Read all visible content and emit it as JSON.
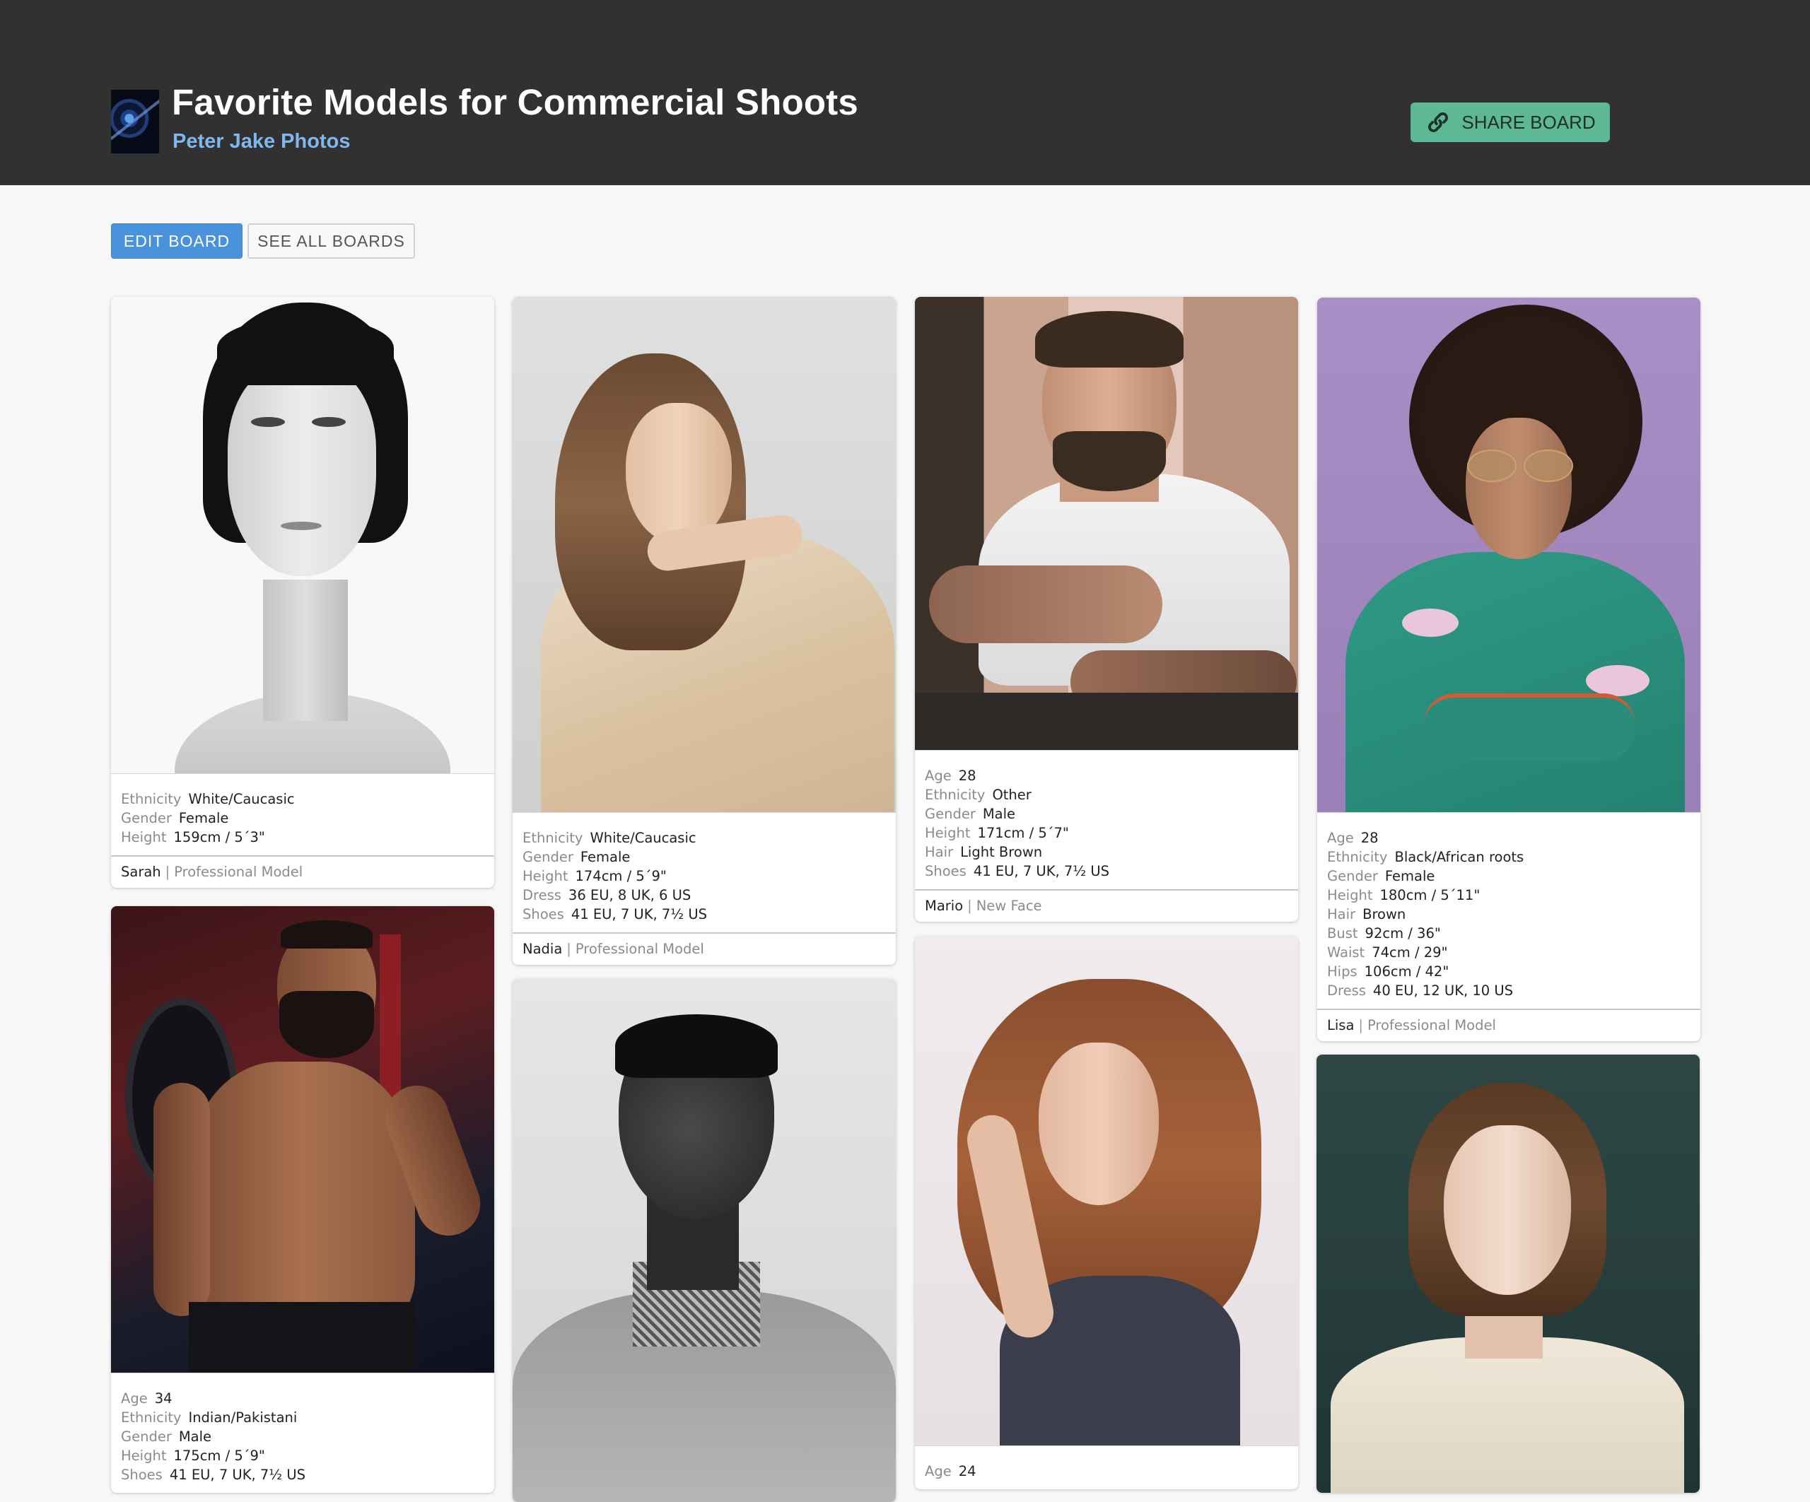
{
  "header": {
    "title": "Favorite Models for Commercial Shoots",
    "owner": "Peter Jake Photos",
    "share_label": "SHARE BOARD"
  },
  "toolbar": {
    "edit_label": "EDIT BOARD",
    "see_all_label": "SEE ALL BOARDS"
  },
  "cards": [
    {
      "name": "Sarah",
      "role": "Professional Model",
      "details": [
        {
          "k": "Ethnicity",
          "v": "White/Caucasic"
        },
        {
          "k": "Gender",
          "v": "Female"
        },
        {
          "k": "Height",
          "v": "159cm / 5´3\""
        }
      ]
    },
    {
      "name": "Nadia",
      "role": "Professional Model",
      "details": [
        {
          "k": "Ethnicity",
          "v": "White/Caucasic"
        },
        {
          "k": "Gender",
          "v": "Female"
        },
        {
          "k": "Height",
          "v": "174cm / 5´9\""
        },
        {
          "k": "Dress",
          "v": "36 EU, 8 UK, 6 US"
        },
        {
          "k": "Shoes",
          "v": "41 EU, 7 UK, 7½ US"
        }
      ]
    },
    {
      "name": "Mario",
      "role": "New Face",
      "details": [
        {
          "k": "Age",
          "v": "28"
        },
        {
          "k": "Ethnicity",
          "v": "Other"
        },
        {
          "k": "Gender",
          "v": "Male"
        },
        {
          "k": "Height",
          "v": "171cm / 5´7\""
        },
        {
          "k": "Hair",
          "v": "Light Brown"
        },
        {
          "k": "Shoes",
          "v": "41 EU, 7 UK, 7½ US"
        }
      ]
    },
    {
      "name": "Lisa",
      "role": "Professional Model",
      "details": [
        {
          "k": "Age",
          "v": "28"
        },
        {
          "k": "Ethnicity",
          "v": "Black/African roots"
        },
        {
          "k": "Gender",
          "v": "Female"
        },
        {
          "k": "Height",
          "v": "180cm / 5´11\""
        },
        {
          "k": "Hair",
          "v": "Brown"
        },
        {
          "k": "Bust",
          "v": "92cm / 36\""
        },
        {
          "k": "Waist",
          "v": "74cm / 29\""
        },
        {
          "k": "Hips",
          "v": "106cm / 42\""
        },
        {
          "k": "Dress",
          "v": "40 EU, 12 UK, 10 US"
        }
      ]
    },
    {
      "details": [
        {
          "k": "Age",
          "v": "34"
        },
        {
          "k": "Ethnicity",
          "v": "Indian/Pakistani"
        },
        {
          "k": "Gender",
          "v": "Male"
        },
        {
          "k": "Height",
          "v": "175cm / 5´9\""
        },
        {
          "k": "Shoes",
          "v": "41 EU, 7 UK, 7½ US"
        }
      ]
    },
    {
      "details": []
    },
    {
      "details": [
        {
          "k": "Age",
          "v": "24"
        }
      ]
    },
    {
      "details": []
    }
  ],
  "colors": {
    "header_bg": "#313131",
    "owner_link": "#7fb8ee",
    "share_button": "#5db896",
    "edit_button": "#4a93dc"
  }
}
